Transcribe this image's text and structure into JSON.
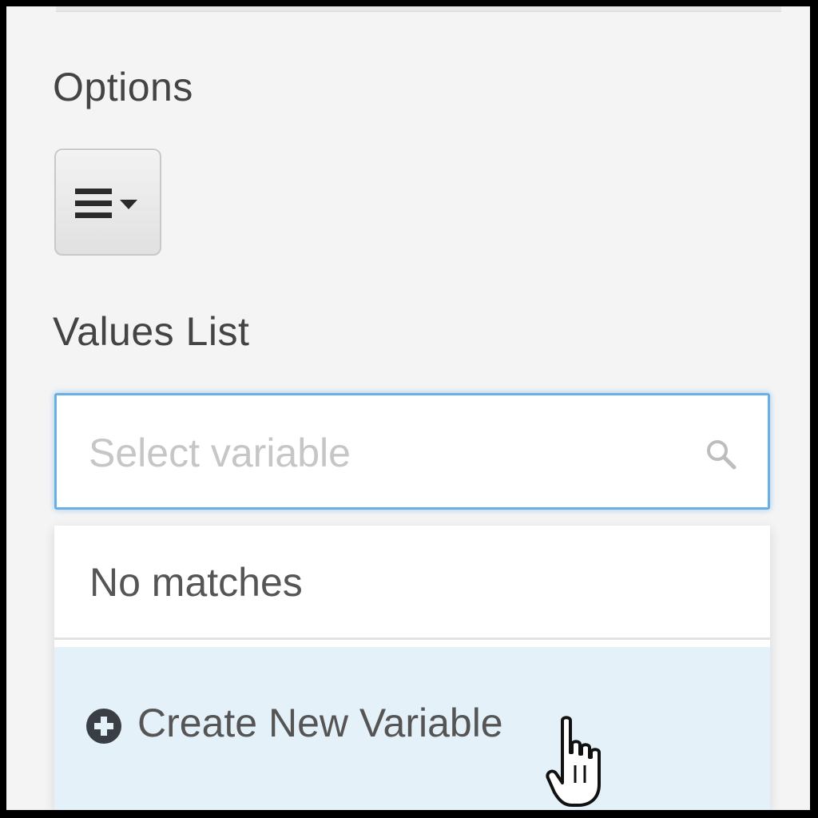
{
  "panel": {
    "options_label": "Options",
    "values_list_label": "Values List"
  },
  "options_button": {
    "icon": "list-dropdown-icon"
  },
  "values_select": {
    "placeholder": "Select variable",
    "value": "",
    "icon": "search-icon"
  },
  "dropdown": {
    "no_matches_text": "No matches",
    "create_item_label": "Create New Variable",
    "create_item_icon": "plus-circle-icon"
  },
  "colors": {
    "focus_border": "#6aaee6",
    "highlight_row": "#e4f1f9",
    "panel_background": "#f4f4f4"
  }
}
